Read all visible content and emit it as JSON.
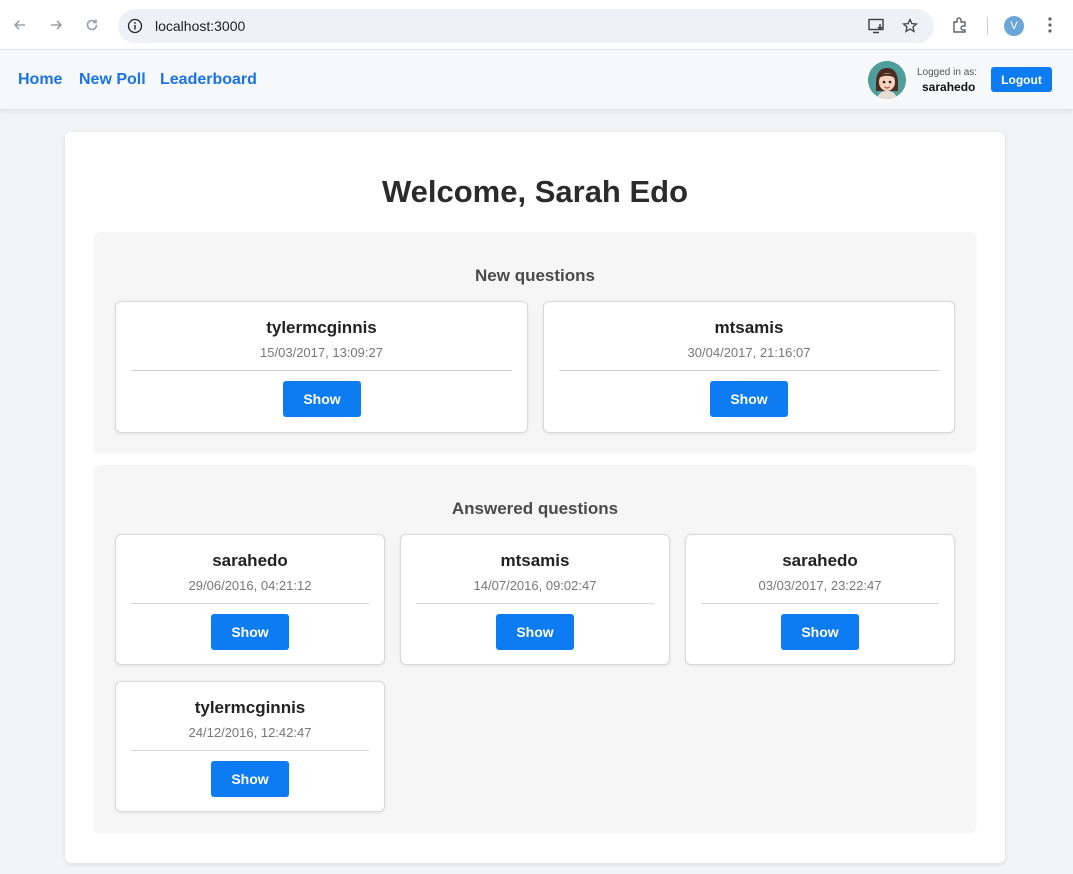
{
  "browser": {
    "url": "localhost:3000",
    "profile_initial": "V"
  },
  "nav": {
    "links": [
      "Home",
      "New Poll",
      "Leaderboard"
    ],
    "logged_in_label": "Logged in as:",
    "username": "sarahedo",
    "logout_label": "Logout"
  },
  "main": {
    "welcome": "Welcome, Sarah Edo",
    "new_section": {
      "title": "New questions",
      "questions": [
        {
          "author": "tylermcginnis",
          "date": "15/03/2017, 13:09:27",
          "button": "Show"
        },
        {
          "author": "mtsamis",
          "date": "30/04/2017, 21:16:07",
          "button": "Show"
        }
      ]
    },
    "answered_section": {
      "title": "Answered questions",
      "questions": [
        {
          "author": "sarahedo",
          "date": "29/06/2016, 04:21:12",
          "button": "Show"
        },
        {
          "author": "mtsamis",
          "date": "14/07/2016, 09:02:47",
          "button": "Show"
        },
        {
          "author": "sarahedo",
          "date": "03/03/2017, 23:22:47",
          "button": "Show"
        },
        {
          "author": "tylermcginnis",
          "date": "24/12/2016, 12:42:47",
          "button": "Show"
        }
      ]
    }
  },
  "colors": {
    "accent": "#0d7cf2",
    "link": "#1a73e8"
  }
}
